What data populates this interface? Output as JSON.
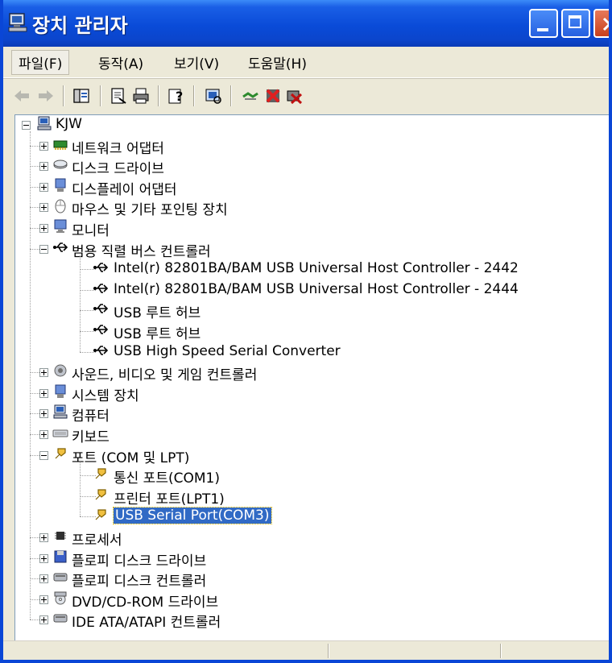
{
  "window": {
    "title": "장치 관리자"
  },
  "menu": {
    "file": "파일(F)",
    "action": "동작(A)",
    "view": "보기(V)",
    "help": "도움말(H)"
  },
  "tree": {
    "root": "KJW",
    "categories": [
      {
        "label": "네트워크 어댑터",
        "icon": "network-adapter-icon"
      },
      {
        "label": "디스크 드라이브",
        "icon": "disk-drive-icon"
      },
      {
        "label": "디스플레이 어댑터",
        "icon": "display-adapter-icon"
      },
      {
        "label": "마우스 및 기타 포인팅 장치",
        "icon": "mouse-icon"
      },
      {
        "label": "모니터",
        "icon": "monitor-icon"
      },
      {
        "label": "범용 직렬 버스 컨트롤러",
        "icon": "usb-icon",
        "children": [
          "Intel(r) 82801BA/BAM USB Universal Host Controller - 2442",
          "Intel(r) 82801BA/BAM USB Universal Host Controller - 2444",
          "USB 루트 허브",
          "USB 루트 허브",
          "USB High Speed Serial Converter"
        ]
      },
      {
        "label": "사운드, 비디오 및 게임 컨트롤러",
        "icon": "sound-icon"
      },
      {
        "label": "시스템 장치",
        "icon": "system-icon"
      },
      {
        "label": "컴퓨터",
        "icon": "computer-icon"
      },
      {
        "label": "키보드",
        "icon": "keyboard-icon"
      },
      {
        "label": "포트 (COM 및 LPT)",
        "icon": "port-icon",
        "children": [
          "통신 포트(COM1)",
          "프린터 포트(LPT1)",
          "USB Serial Port(COM3)"
        ]
      },
      {
        "label": "프로세서",
        "icon": "processor-icon"
      },
      {
        "label": "플로피 디스크 드라이브",
        "icon": "floppy-drive-icon"
      },
      {
        "label": "플로피 디스크 컨트롤러",
        "icon": "floppy-controller-icon"
      },
      {
        "label": "DVD/CD-ROM 드라이브",
        "icon": "dvd-icon"
      },
      {
        "label": "IDE ATA/ATAPI 컨트롤러",
        "icon": "ide-icon"
      }
    ]
  },
  "colors": {
    "titlebar": "#0a4bd8",
    "selection": "#316ac5"
  }
}
